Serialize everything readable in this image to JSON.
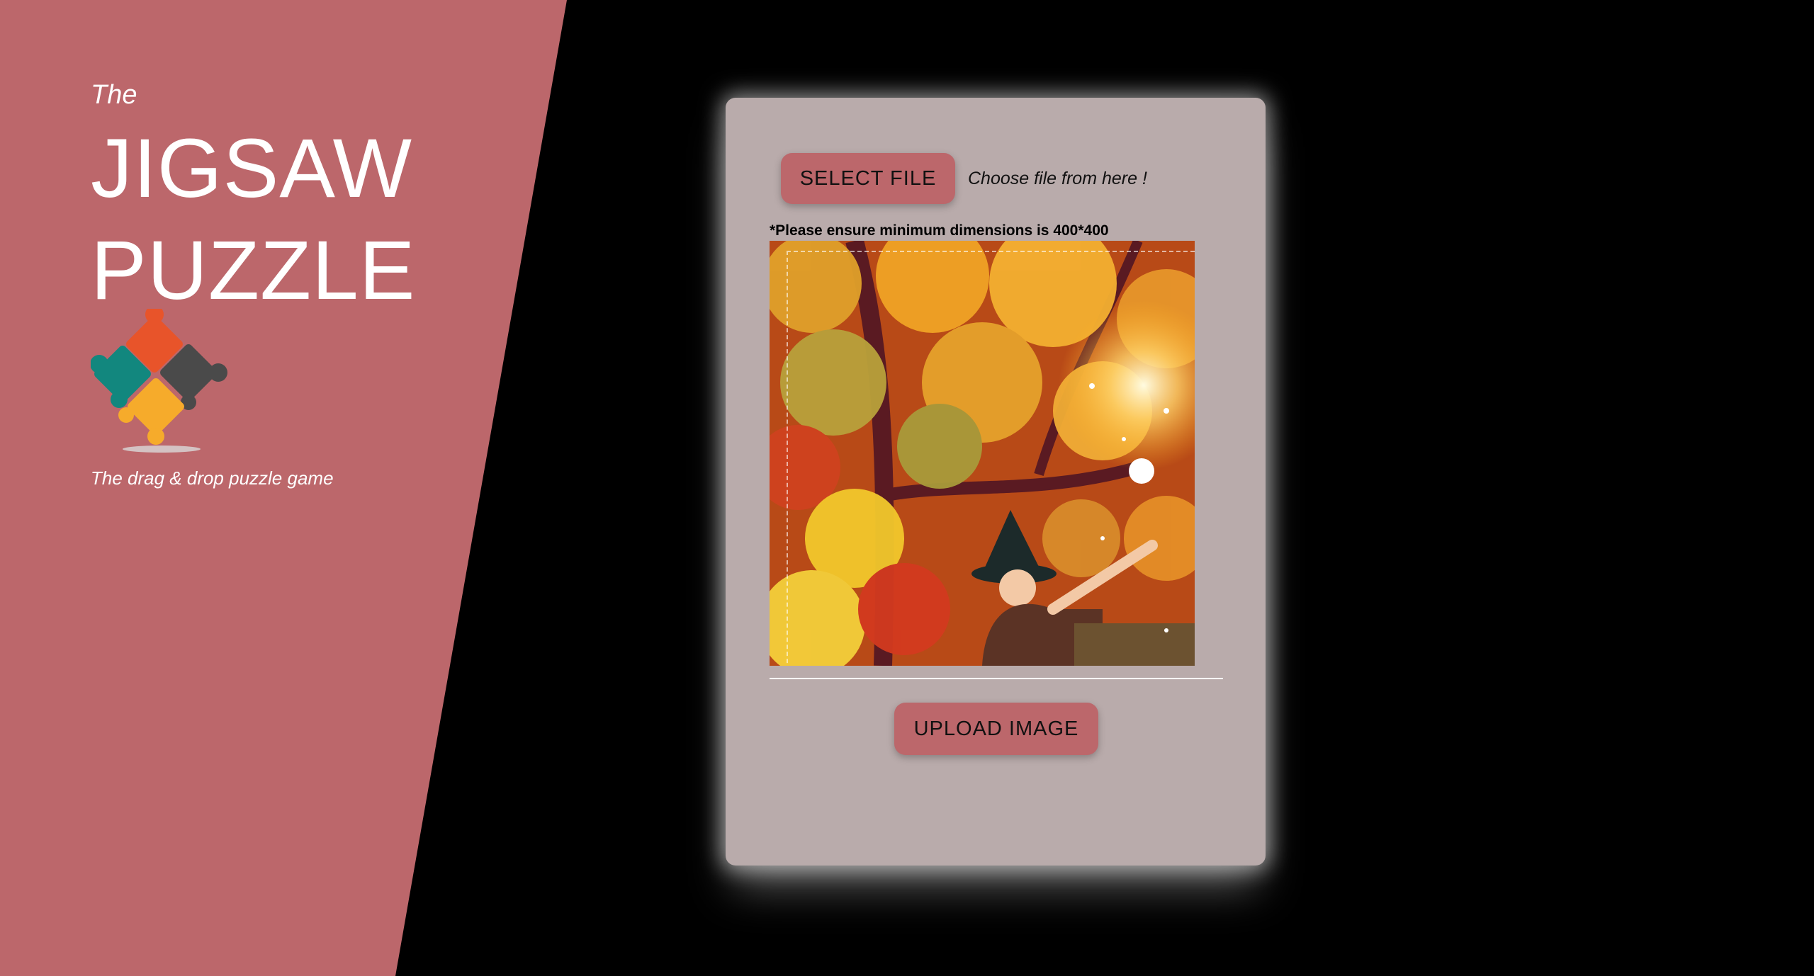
{
  "brand": {
    "the": "The",
    "title_line1": "JIGSAW",
    "title_line2": "PUZZLE",
    "tagline": "The drag & drop puzzle game",
    "logo_icon": "puzzle-pieces-icon"
  },
  "uploader": {
    "select_label": "SELECT FILE",
    "choose_text": "Choose file from here !",
    "note": "*Please ensure minimum dimensions is 400*400",
    "upload_label": "UPLOAD IMAGE",
    "preview_image": "autumn leaves witch with magic wand illustration"
  },
  "colors": {
    "accent": "#bc676b",
    "card": "#b9abab",
    "background": "#000000"
  }
}
